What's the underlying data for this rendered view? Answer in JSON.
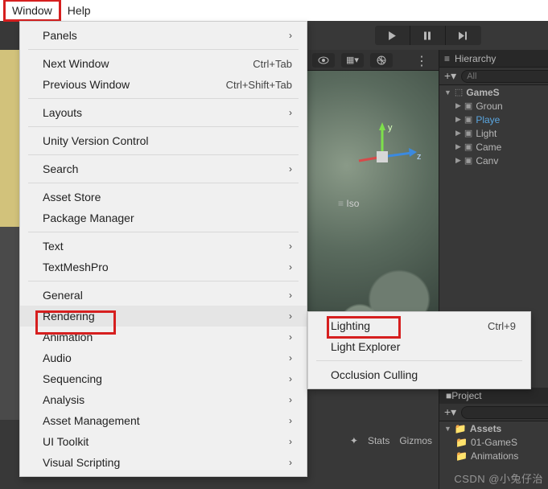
{
  "menubar": {
    "window": "Window",
    "help": "Help"
  },
  "window_menu": {
    "panels": "Panels",
    "next_window": "Next Window",
    "next_window_shortcut": "Ctrl+Tab",
    "previous_window": "Previous Window",
    "previous_window_shortcut": "Ctrl+Shift+Tab",
    "layouts": "Layouts",
    "uvc": "Unity Version Control",
    "search": "Search",
    "asset_store": "Asset Store",
    "package_manager": "Package Manager",
    "text": "Text",
    "textmeshpro": "TextMeshPro",
    "general": "General",
    "rendering": "Rendering",
    "animation": "Animation",
    "audio": "Audio",
    "sequencing": "Sequencing",
    "analysis": "Analysis",
    "asset_management": "Asset Management",
    "ui_toolkit": "UI Toolkit",
    "visual_scripting": "Visual Scripting"
  },
  "rendering_submenu": {
    "lighting": "Lighting",
    "lighting_shortcut": "Ctrl+9",
    "light_explorer": "Light Explorer",
    "occlusion_culling": "Occlusion Culling"
  },
  "hierarchy": {
    "title": "Hierarchy",
    "search_placeholder": "All",
    "items": [
      {
        "label": "GameS",
        "bold": true
      },
      {
        "label": "Groun"
      },
      {
        "label": "Playe",
        "selected": true
      },
      {
        "label": "Light"
      },
      {
        "label": "Came"
      },
      {
        "label": "Canv"
      }
    ]
  },
  "scene": {
    "iso_label": "Iso",
    "axis_y": "y",
    "axis_z": "z",
    "stats": "Stats",
    "gizmos": "Gizmos"
  },
  "project": {
    "tab": "Project",
    "search_placeholder": "",
    "assets": "Assets",
    "folder1": "01-GameS",
    "folder2": "Animations"
  },
  "watermark": "CSDN @小兔仔治"
}
